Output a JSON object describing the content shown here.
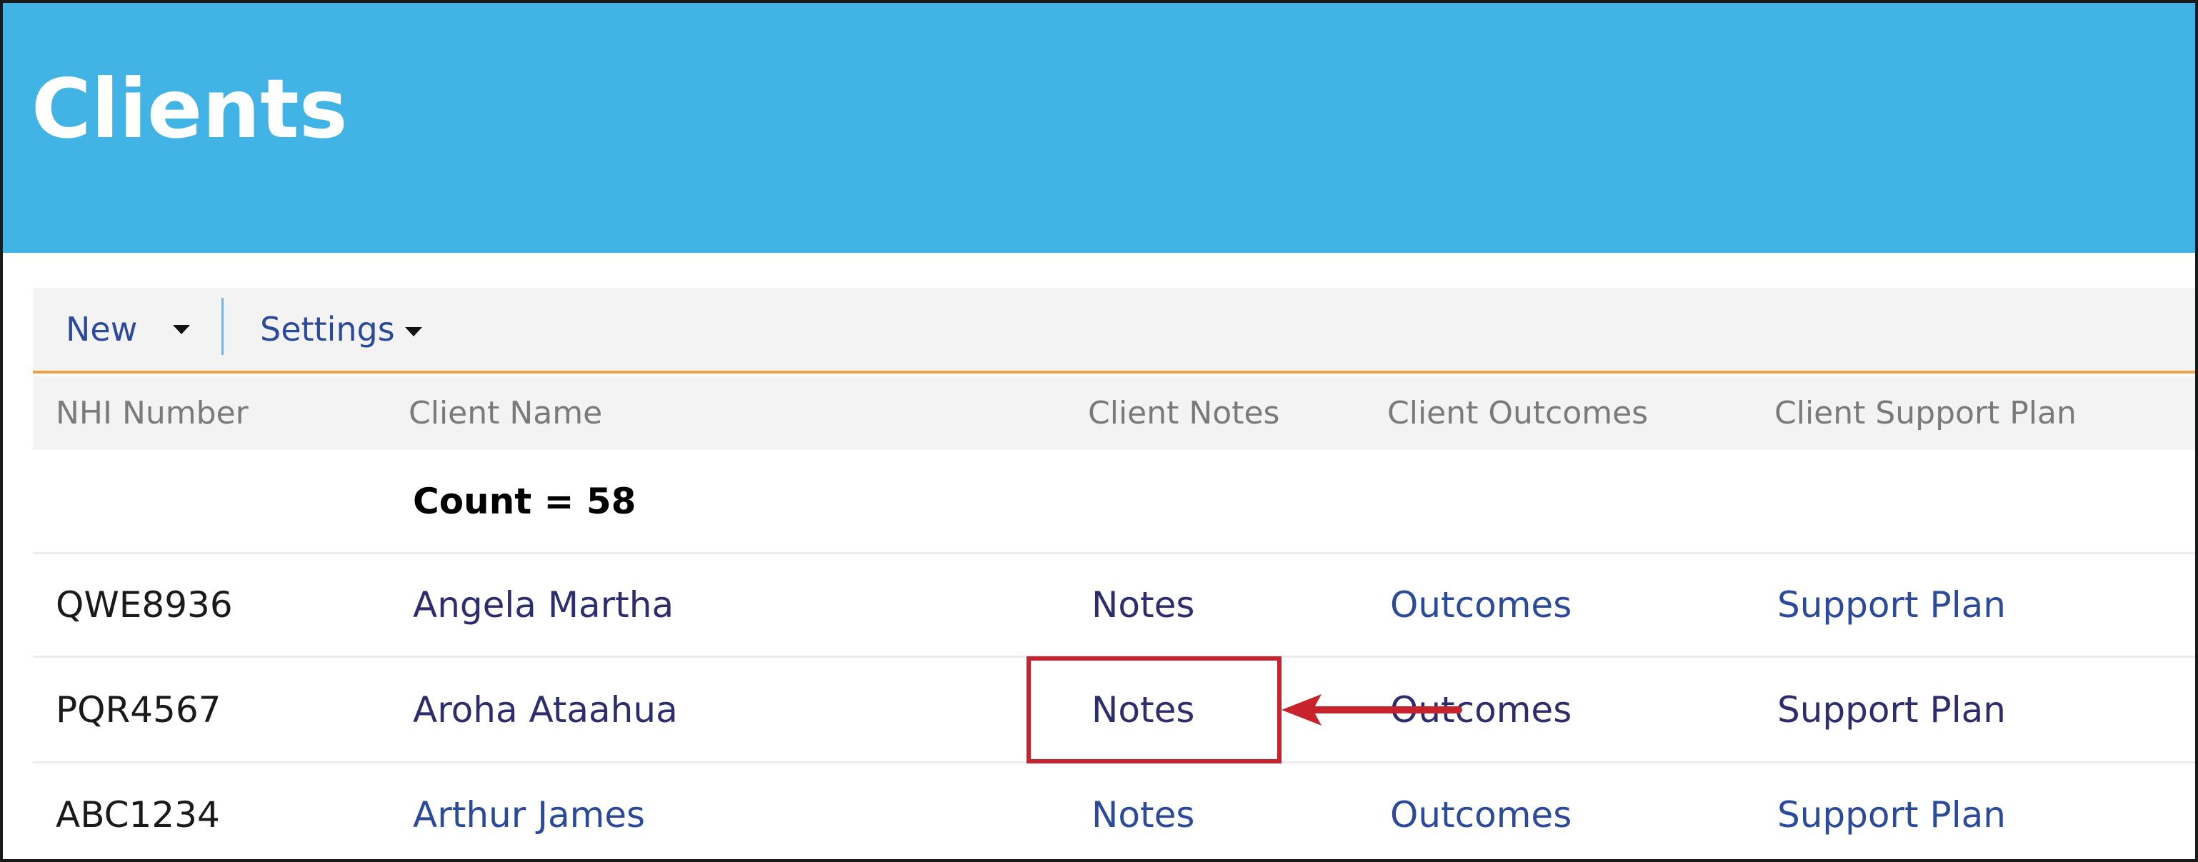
{
  "header": {
    "title": "Clients",
    "background_color": "#41b3e5"
  },
  "toolbar": {
    "new_label": "New",
    "settings_label": "Settings",
    "accent_color": "#f0a04b"
  },
  "table": {
    "columns": [
      "NHI Number",
      "Client Name",
      "Client Notes",
      "Client Outcomes",
      "Client Support Plan"
    ],
    "count_label": "Count = 58",
    "rows": [
      {
        "nhi": "QWE8936",
        "name": "Angela Martha",
        "notes": "Notes",
        "outcomes": "Outcomes",
        "plan": "Support Plan"
      },
      {
        "nhi": "PQR4567",
        "name": "Aroha Ataahua",
        "notes": "Notes",
        "outcomes": "Outcomes",
        "plan": "Support Plan"
      },
      {
        "nhi": "ABC1234",
        "name": "Arthur James",
        "notes": "Notes",
        "outcomes": "Outcomes",
        "plan": "Support Plan"
      }
    ],
    "link_color": "#2b4a9a"
  },
  "annotation": {
    "highlight_color": "#c8232c",
    "target": "Notes"
  }
}
